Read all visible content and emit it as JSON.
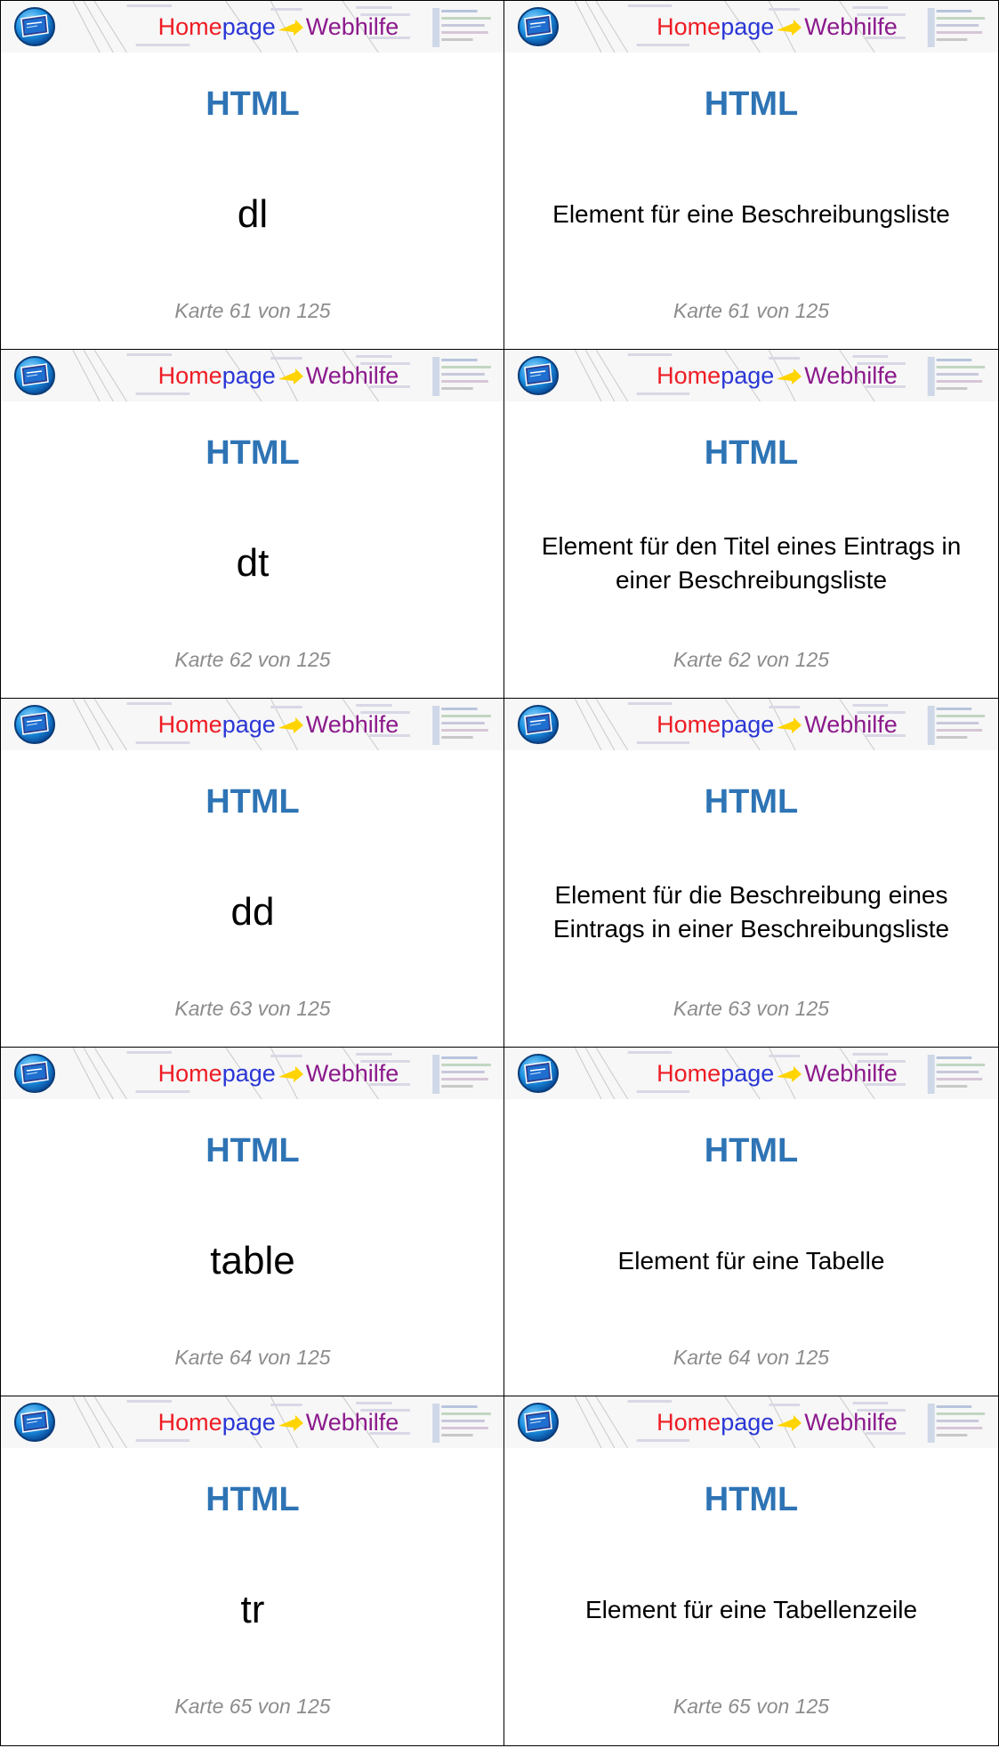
{
  "brand": {
    "home": "Home",
    "page": "page",
    "web": "Webhilfe"
  },
  "subject": "HTML",
  "colors": {
    "subject": "#2e74b5",
    "home": "#ee1c24",
    "page": "#2a36d6",
    "web": "#8c1a8c",
    "footer": "#8c8c8c",
    "arrow": "#ffd400"
  },
  "logo_icon": "screen-globe-icon",
  "cards": [
    {
      "front": "dl",
      "back": "Element für eine Beschreibungsliste",
      "footer": "Karte 61 von 125"
    },
    {
      "front": "dt",
      "back": "Element für den Titel eines Eintrags in einer Beschreibungsliste",
      "footer": "Karte 62 von 125"
    },
    {
      "front": "dd",
      "back": "Element für die Beschreibung eines Eintrags in einer Beschreibungsliste",
      "footer": "Karte 63 von 125"
    },
    {
      "front": "table",
      "back": "Element für eine Tabelle",
      "footer": "Karte 64 von 125"
    },
    {
      "front": "tr",
      "back": "Element für eine Tabellenzeile",
      "footer": "Karte 65 von 125"
    }
  ]
}
